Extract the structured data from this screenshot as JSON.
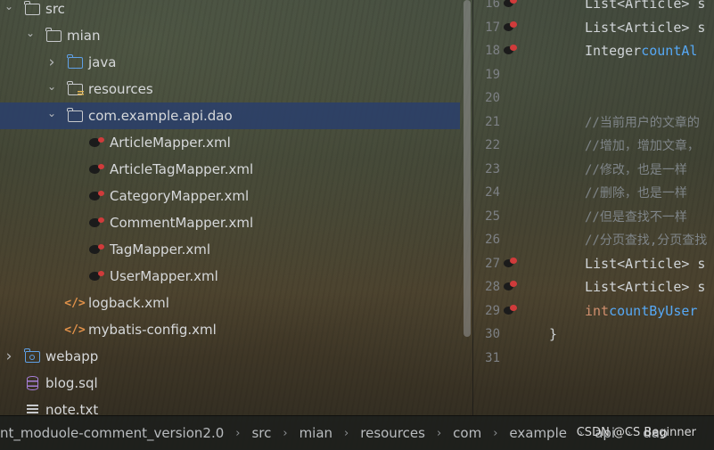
{
  "project_tree": [
    {
      "label": "src",
      "indent": 0,
      "chevron": "down",
      "icon": "folder-icon",
      "selected": false
    },
    {
      "label": "mian",
      "indent": 1,
      "chevron": "down",
      "icon": "folder-icon",
      "selected": false
    },
    {
      "label": "java",
      "indent": 2,
      "chevron": "right",
      "icon": "source-folder-icon",
      "selected": false
    },
    {
      "label": "resources",
      "indent": 2,
      "chevron": "down",
      "icon": "resources-folder-icon",
      "selected": false
    },
    {
      "label": "com.example.api.dao",
      "indent": 3,
      "chevron": "down",
      "icon": "folder-icon",
      "selected": true
    },
    {
      "label": "ArticleMapper.xml",
      "indent": 4,
      "chevron": "",
      "icon": "mybatis-xml-icon",
      "selected": false
    },
    {
      "label": "ArticleTagMapper.xml",
      "indent": 4,
      "chevron": "",
      "icon": "mybatis-xml-icon",
      "selected": false
    },
    {
      "label": "CategoryMapper.xml",
      "indent": 4,
      "chevron": "",
      "icon": "mybatis-xml-icon",
      "selected": false
    },
    {
      "label": "CommentMapper.xml",
      "indent": 4,
      "chevron": "",
      "icon": "mybatis-xml-icon",
      "selected": false
    },
    {
      "label": "TagMapper.xml",
      "indent": 4,
      "chevron": "",
      "icon": "mybatis-xml-icon",
      "selected": false
    },
    {
      "label": "UserMapper.xml",
      "indent": 4,
      "chevron": "",
      "icon": "mybatis-xml-icon",
      "selected": false
    },
    {
      "label": "logback.xml",
      "indent": 3,
      "chevron": "",
      "icon": "xml-code-icon",
      "selected": false
    },
    {
      "label": "mybatis-config.xml",
      "indent": 3,
      "chevron": "",
      "icon": "xml-code-icon",
      "selected": false
    },
    {
      "label": "webapp",
      "indent": 0,
      "chevron": "right",
      "icon": "web-folder-icon",
      "selected": false
    },
    {
      "label": "blog.sql",
      "indent": 0,
      "chevron": "",
      "icon": "sql-file-icon",
      "selected": false
    },
    {
      "label": "note.txt",
      "indent": 0,
      "chevron": "",
      "icon": "text-file-icon",
      "selected": false
    }
  ],
  "editor": {
    "lines": [
      {
        "num": "16",
        "gutter_icon": true,
        "kind": "code",
        "parts": [
          {
            "t": "List<Article> s",
            "c": "plain"
          }
        ]
      },
      {
        "num": "17",
        "gutter_icon": true,
        "kind": "code",
        "parts": [
          {
            "t": "List<Article> s",
            "c": "plain"
          }
        ]
      },
      {
        "num": "18",
        "gutter_icon": true,
        "kind": "code",
        "parts": [
          {
            "t": "Integer ",
            "c": "plain"
          },
          {
            "t": "countAl",
            "c": "method"
          }
        ]
      },
      {
        "num": "19",
        "gutter_icon": false,
        "kind": "code",
        "parts": []
      },
      {
        "num": "20",
        "gutter_icon": false,
        "kind": "code",
        "parts": []
      },
      {
        "num": "21",
        "gutter_icon": false,
        "kind": "comment",
        "parts": [
          {
            "t": "//当前用户的文章的",
            "c": "comment"
          }
        ]
      },
      {
        "num": "22",
        "gutter_icon": false,
        "kind": "comment",
        "parts": [
          {
            "t": "//增加，增加文章，",
            "c": "comment"
          }
        ]
      },
      {
        "num": "23",
        "gutter_icon": false,
        "kind": "comment",
        "parts": [
          {
            "t": "//修改，也是一样",
            "c": "comment"
          }
        ]
      },
      {
        "num": "24",
        "gutter_icon": false,
        "kind": "comment",
        "parts": [
          {
            "t": "//删除，也是一样",
            "c": "comment"
          }
        ]
      },
      {
        "num": "25",
        "gutter_icon": false,
        "kind": "comment",
        "parts": [
          {
            "t": "//但是查找不一样",
            "c": "comment"
          }
        ]
      },
      {
        "num": "26",
        "gutter_icon": false,
        "kind": "comment",
        "parts": [
          {
            "t": "//分页查找,分页查找",
            "c": "comment"
          }
        ]
      },
      {
        "num": "27",
        "gutter_icon": true,
        "kind": "code",
        "parts": [
          {
            "t": "List<Article> s",
            "c": "plain"
          }
        ]
      },
      {
        "num": "28",
        "gutter_icon": true,
        "kind": "code",
        "parts": [
          {
            "t": "List<Article> s",
            "c": "plain"
          }
        ]
      },
      {
        "num": "29",
        "gutter_icon": true,
        "kind": "code",
        "parts": [
          {
            "t": "int ",
            "c": "keyword"
          },
          {
            "t": "countByUser",
            "c": "method"
          }
        ]
      },
      {
        "num": "30",
        "gutter_icon": false,
        "kind": "brace",
        "parts": [
          {
            "t": "}",
            "c": "plain"
          }
        ]
      },
      {
        "num": "31",
        "gutter_icon": false,
        "kind": "code",
        "parts": []
      }
    ]
  },
  "breadcrumb": [
    "nt_moduole-comment_version2.0",
    "src",
    "mian",
    "resources",
    "com",
    "example",
    "api",
    "dao"
  ],
  "watermark": "CSDN @CS Beginner",
  "colors": {
    "selection": "#2c4068",
    "keyword": "#cf8e6d",
    "method": "#56a8f5",
    "comment": "#7f8589",
    "folder_blue": "#5fa0e6"
  }
}
